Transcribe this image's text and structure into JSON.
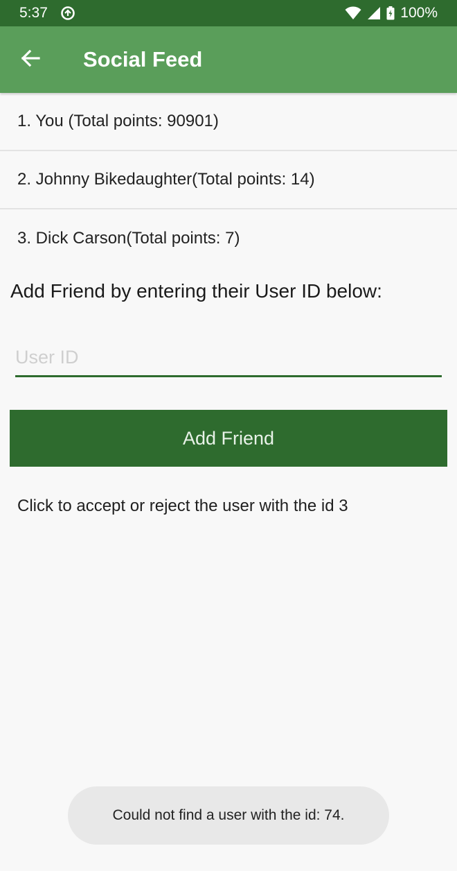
{
  "status_bar": {
    "time": "5:37",
    "battery": "100%"
  },
  "app_bar": {
    "title": "Social Feed",
    "back_icon": "arrow-back-icon"
  },
  "leaderboard": [
    {
      "text": "1. You (Total points: 90901)"
    },
    {
      "text": "2. Johnny Bikedaughter(Total points: 14)"
    },
    {
      "text": "3. Dick Carson(Total points: 7)"
    }
  ],
  "add_friend": {
    "instructions": "Add Friend by entering their User ID below:",
    "input_value": "",
    "input_placeholder": "User ID",
    "button_label": "Add Friend"
  },
  "pending_request": "Click to accept or reject the user with the id 3",
  "toast": "Could not find a user with the id: 74.",
  "colors": {
    "status_bar": "#2e6b2e",
    "app_bar": "#5a9e5a",
    "accent": "#2e6b2e",
    "background": "#f8f8f8"
  }
}
